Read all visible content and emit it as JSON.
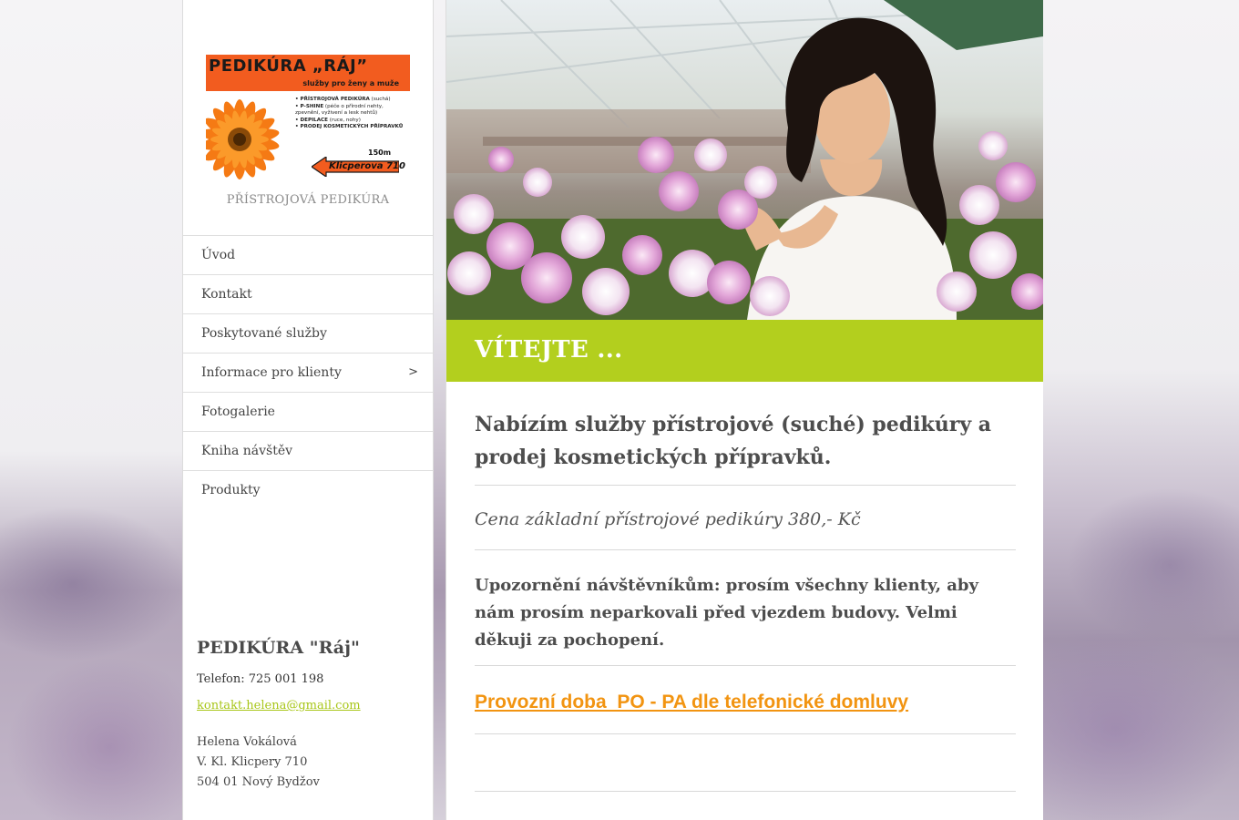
{
  "logo": {
    "title": "PEDIKÚRA „RÁJ”",
    "subtitle": "služby pro ženy a muže",
    "items": [
      {
        "bold": "• PŘÍSTROJOVÁ PEDIKÚRA",
        "rest": " (suchá)"
      },
      {
        "bold": "• P-SHINE",
        "rest": " (péče o přírodní nehty, zpevnění, vyživení a lesk nehtů)"
      },
      {
        "bold": "• DEPILACE",
        "rest": " (ruce, nohy)"
      },
      {
        "bold": "• PRODEJ KOSMETICKÝCH PŘÍPRAVKŮ",
        "rest": ""
      }
    ],
    "distance": "150m",
    "street": "Klicperova 710"
  },
  "sidebar": {
    "tagline": "PŘÍSTROJOVÁ PEDIKÚRA",
    "nav": [
      {
        "label": "Úvod"
      },
      {
        "label": "Kontakt"
      },
      {
        "label": "Poskytované služby"
      },
      {
        "label": "Informace pro klienty",
        "arrow": ">"
      },
      {
        "label": "Fotogalerie"
      },
      {
        "label": "Kniha návštěv"
      },
      {
        "label": "Produkty"
      }
    ],
    "contact": {
      "title": "PEDIKÚRA \"Ráj\"",
      "phone": "Telefon: 725 001 198",
      "email": "kontakt.helena@gmail.com",
      "address": [
        "Helena Vokálová",
        "V. Kl. Klicpery 710",
        "504 01 Nový Bydžov"
      ]
    }
  },
  "main": {
    "banner_title": "VÍTEJTE ...",
    "lead": "Nabízím služby přístrojové (suché) pedikúry a prodej kosmetických přípravků.",
    "price": "Cena základní přístrojové pedikúry 380,- Kč",
    "notice": "Upozornění návštěvníkům: prosím všechny klienty, aby nám prosím neparkovali před vjezdem budovy. Velmi děkuji za pochopení.",
    "hours": "Provozní doba  PO - PA dle telefonické domluvy"
  },
  "colors": {
    "accent_green": "#b3cf1e",
    "link_orange": "#f29411",
    "email_green": "#a8c619",
    "logo_orange": "#f25c1f"
  }
}
